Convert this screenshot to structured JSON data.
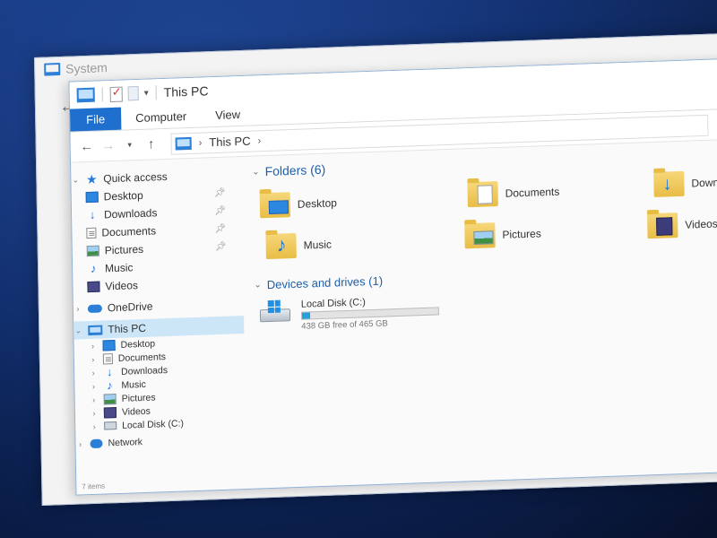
{
  "system_window": {
    "title": "System"
  },
  "explorer": {
    "title": "This PC",
    "ribbon_tabs": [
      "File",
      "Computer",
      "View"
    ],
    "address": {
      "crumb": "This PC"
    },
    "nav_pane": {
      "quick_access": {
        "label": "Quick access",
        "items": [
          "Desktop",
          "Downloads",
          "Documents",
          "Pictures",
          "Music",
          "Videos"
        ]
      },
      "onedrive": "OneDrive",
      "this_pc": {
        "label": "This PC",
        "items": [
          "Desktop",
          "Documents",
          "Downloads",
          "Music",
          "Pictures",
          "Videos",
          "Local Disk (C:)"
        ]
      },
      "network": "Network"
    },
    "folders_group": {
      "header": "Folders (6)",
      "items": [
        "Desktop",
        "Documents",
        "Downloads",
        "Music",
        "Pictures",
        "Videos"
      ]
    },
    "drives_group": {
      "header": "Devices and drives (1)",
      "drive": {
        "name": "Local Disk (C:)",
        "free_text": "438 GB free of 465 GB",
        "used_fraction": 0.058
      }
    },
    "status": "7 items"
  },
  "colors": {
    "accent": "#1f6fce",
    "drive_bar": "#26a0da",
    "selection": "#cde6f7"
  }
}
